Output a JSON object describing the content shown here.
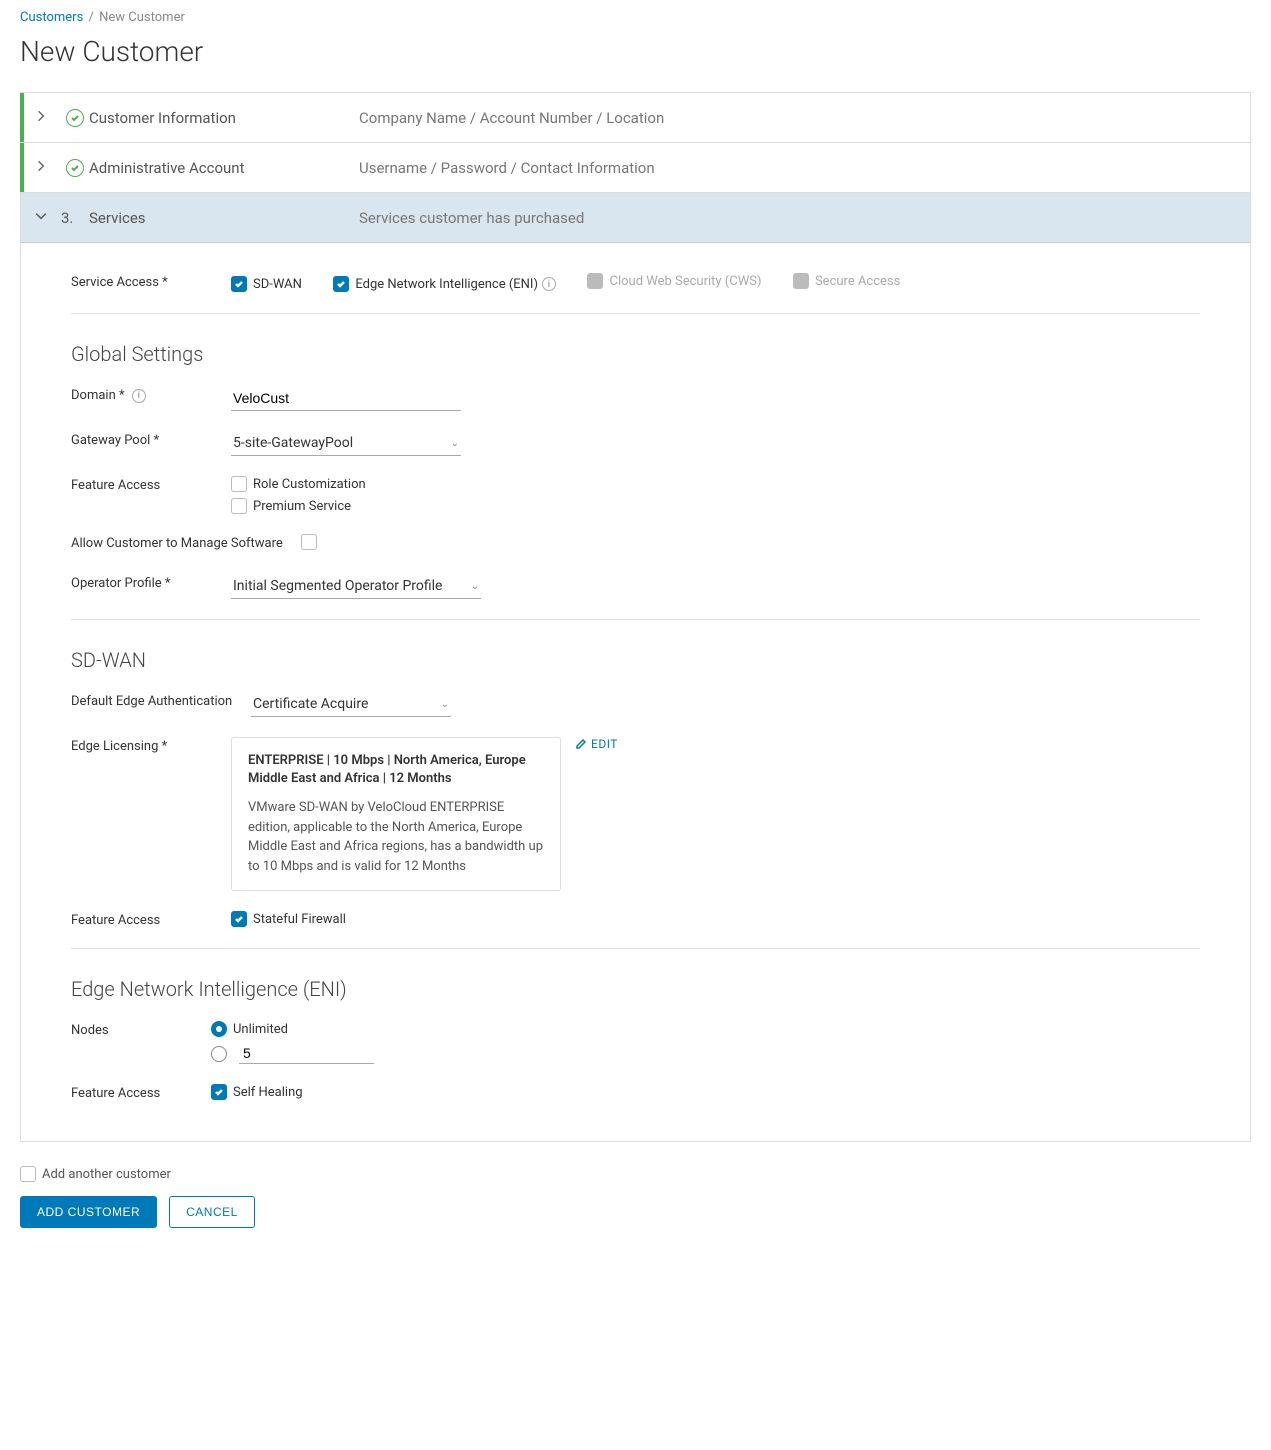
{
  "breadcrumb": {
    "root": "Customers",
    "current": "New Customer"
  },
  "page_title": "New Customer",
  "steps": {
    "s1": {
      "label": "Customer Information",
      "desc": "Company Name / Account Number / Location"
    },
    "s2": {
      "label": "Administrative Account",
      "desc": "Username / Password / Contact Information"
    },
    "s3": {
      "num": "3.",
      "label": "Services",
      "desc": "Services customer has purchased"
    }
  },
  "service_access": {
    "label": "Service Access *",
    "options": {
      "sdwan": "SD-WAN",
      "eni": "Edge Network Intelligence (ENI)",
      "cws": "Cloud Web Security (CWS)",
      "sa": "Secure Access"
    }
  },
  "global": {
    "title": "Global Settings",
    "domain_label": "Domain *",
    "domain_value": "VeloCust",
    "gateway_label": "Gateway Pool *",
    "gateway_value": "5-site-GatewayPool",
    "feature_access_label": "Feature Access",
    "role_customization": "Role Customization",
    "premium_service": "Premium Service",
    "allow_manage_label": "Allow Customer to Manage Software",
    "operator_profile_label": "Operator Profile *",
    "operator_profile_value": "Initial Segmented Operator Profile"
  },
  "sdwan": {
    "title": "SD-WAN",
    "default_edge_auth_label": "Default Edge Authentication",
    "default_edge_auth_value": "Certificate Acquire",
    "edge_licensing_label": "Edge Licensing *",
    "license_title": "ENTERPRISE | 10 Mbps | North America, Europe Middle East and Africa | 12 Months",
    "license_desc": "VMware SD-WAN by VeloCloud ENTERPRISE edition, applicable to the North America, Europe Middle East and Africa regions, has a bandwidth up to 10 Mbps and is valid for 12 Months",
    "edit_label": "EDIT",
    "feature_access_label": "Feature Access",
    "stateful_firewall": "Stateful Firewall"
  },
  "eni": {
    "title": "Edge Network Intelligence (ENI)",
    "nodes_label": "Nodes",
    "unlimited": "Unlimited",
    "custom_value": "5",
    "feature_access_label": "Feature Access",
    "self_healing": "Self Healing"
  },
  "footer": {
    "add_another": "Add another customer",
    "add_customer": "ADD CUSTOMER",
    "cancel": "CANCEL"
  }
}
